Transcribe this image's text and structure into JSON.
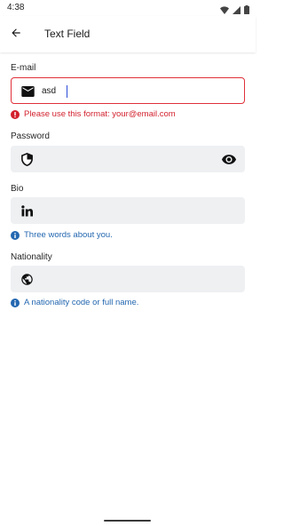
{
  "status_bar": {
    "time": "4:38"
  },
  "app_bar": {
    "title": "Text Field"
  },
  "fields": {
    "email": {
      "label": "E-mail",
      "value": "asd",
      "error": "Please use this format: your@email.com",
      "error_color": "#e0303a"
    },
    "password": {
      "label": "Password"
    },
    "bio": {
      "label": "Bio",
      "helper": "Three words about you."
    },
    "nationality": {
      "label": "Nationality",
      "helper": "A nationality code or full name."
    }
  },
  "colors": {
    "field_bg": "#eef0f2",
    "info": "#2367b0",
    "error": "#d21f2c"
  },
  "icons": {
    "email": "mail-icon",
    "password": "shield-icon",
    "password_toggle": "eye-icon",
    "bio": "linkedin-icon",
    "nationality": "globe-icon"
  }
}
